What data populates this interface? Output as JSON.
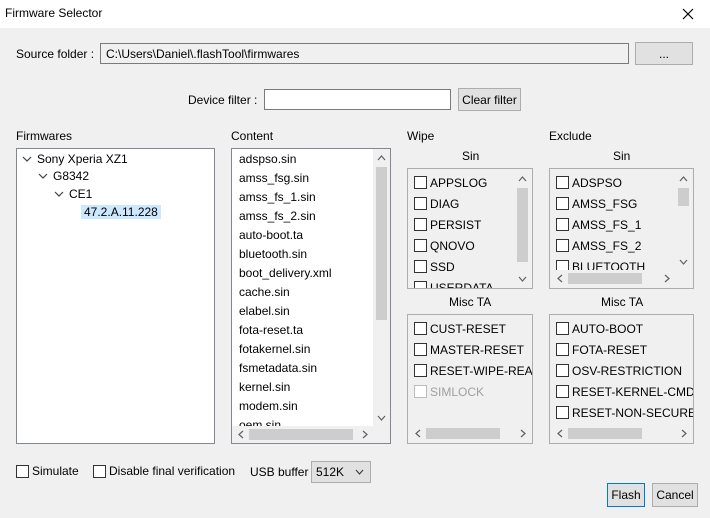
{
  "window": {
    "title": "Firmware Selector"
  },
  "source": {
    "label": "Source folder :",
    "path": "C:\\Users\\Daniel\\.flashTool\\firmwares",
    "browse_label": "..."
  },
  "filter": {
    "label": "Device filter :",
    "value": "",
    "clear_label": "Clear filter"
  },
  "firmwares": {
    "label": "Firmwares",
    "tree": [
      {
        "label": "Sony Xperia XZ1"
      },
      {
        "label": "G8342"
      },
      {
        "label": "CE1"
      },
      {
        "label": "47.2.A.11.228"
      }
    ]
  },
  "content": {
    "label": "Content",
    "items": [
      "adspso.sin",
      "amss_fsg.sin",
      "amss_fs_1.sin",
      "amss_fs_2.sin",
      "auto-boot.ta",
      "bluetooth.sin",
      "boot_delivery.xml",
      "cache.sin",
      "elabel.sin",
      "fota-reset.ta",
      "fotakernel.sin",
      "fsmetadata.sin",
      "kernel.sin",
      "modem.sin",
      "oem.sin"
    ]
  },
  "wipe": {
    "label": "Wipe",
    "sin_label": "Sin",
    "sin_items": [
      "APPSLOG",
      "DIAG",
      "PERSIST",
      "QNOVO",
      "SSD",
      "USERDATA"
    ],
    "misc_label": "Misc TA",
    "misc_items": [
      "CUST-RESET",
      "MASTER-RESET",
      "RESET-WIPE-REASON",
      "SIMLOCK"
    ]
  },
  "exclude": {
    "label": "Exclude",
    "sin_label": "Sin",
    "sin_items": [
      "ADSPSO",
      "AMSS_FSG",
      "AMSS_FS_1",
      "AMSS_FS_2",
      "BLUETOOTH"
    ],
    "misc_label": "Misc TA",
    "misc_items": [
      "AUTO-BOOT",
      "FOTA-RESET",
      "OSV-RESTRICTION",
      "RESET-KERNEL-CMD-DEBUG",
      "RESET-NON-SECURE-ADB"
    ]
  },
  "options": {
    "simulate_label": "Simulate",
    "disable_verif_label": "Disable final verification",
    "usb_buffer_label": "USB buffer",
    "usb_buffer_value": "512K"
  },
  "actions": {
    "flash_label": "Flash",
    "cancel_label": "Cancel"
  }
}
